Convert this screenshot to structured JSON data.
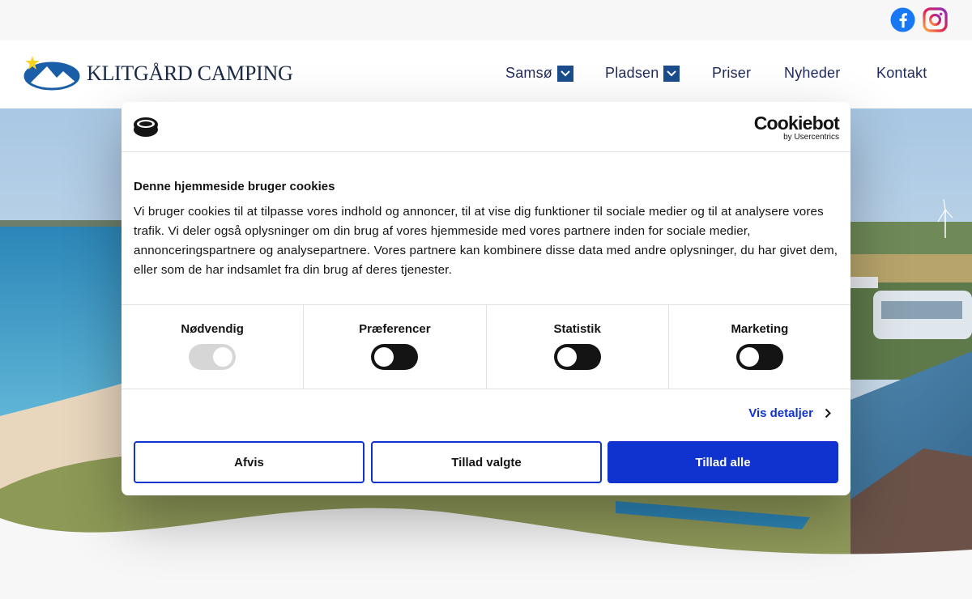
{
  "site": {
    "brand_name": "KLITGÅRD CAMPING",
    "social": [
      "facebook-icon",
      "instagram-icon"
    ]
  },
  "nav": [
    {
      "label": "Samsø",
      "has_dropdown": true
    },
    {
      "label": "Pladsen",
      "has_dropdown": true
    },
    {
      "label": "Priser",
      "has_dropdown": false
    },
    {
      "label": "Nyheder",
      "has_dropdown": false
    },
    {
      "label": "Kontakt",
      "has_dropdown": false
    }
  ],
  "cookie": {
    "provider_name": "Cookiebot",
    "provider_sub": "by Usercentrics",
    "title": "Denne hjemmeside bruger cookies",
    "text": "Vi bruger cookies til at tilpasse vores indhold og annoncer, til at vise dig funktioner til sociale medier og til at analysere vores trafik. Vi deler også oplysninger om din brug af vores hjemmeside med vores partnere inden for sociale medier, annonceringspartnere og analysepartnere. Vores partnere kan kombinere disse data med andre oplysninger, du har givet dem, eller som de har indsamlet fra din brug af deres tjenester.",
    "categories": [
      {
        "label": "Nødvendig",
        "enabled": true,
        "locked": true
      },
      {
        "label": "Præferencer",
        "enabled": false,
        "locked": false
      },
      {
        "label": "Statistik",
        "enabled": false,
        "locked": false
      },
      {
        "label": "Marketing",
        "enabled": false,
        "locked": false
      }
    ],
    "details_label": "Vis detaljer",
    "buttons": {
      "decline": "Afvis",
      "allow_selected": "Tillad valgte",
      "allow_all": "Tillad alle"
    },
    "colors": {
      "accent": "#1032cf"
    }
  }
}
